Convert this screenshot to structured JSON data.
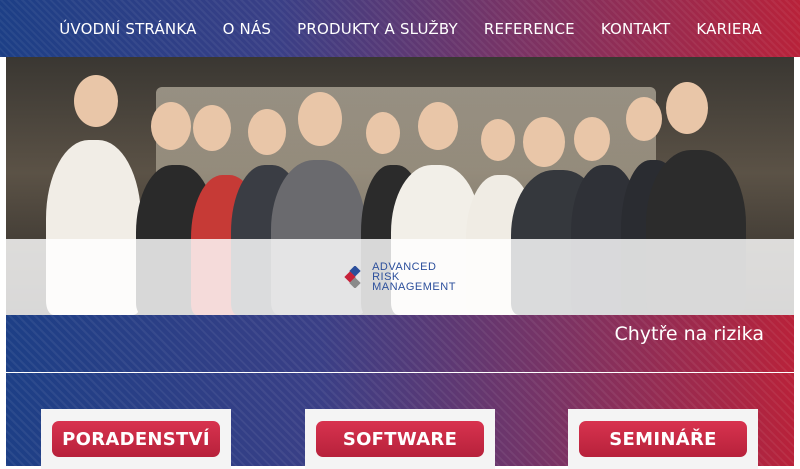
{
  "nav": {
    "items": [
      "ÚVODNÍ STRÁNKA",
      "O NÁS",
      "PRODUKTY A SLUŽBY",
      "REFERENCE",
      "KONTAKT",
      "KARIERA"
    ]
  },
  "hero": {
    "logo_lines": [
      "ADVANCED",
      "RISK",
      "MANAGEMENT"
    ]
  },
  "slogan": "Chytře na rizika",
  "cards": [
    "PORADENSTVÍ",
    "SOFTWARE",
    "SEMINÁŘE"
  ],
  "colors": {
    "brand_blue": "#1d3f86",
    "brand_red": "#b8223a",
    "button_red": "#c92a45"
  }
}
